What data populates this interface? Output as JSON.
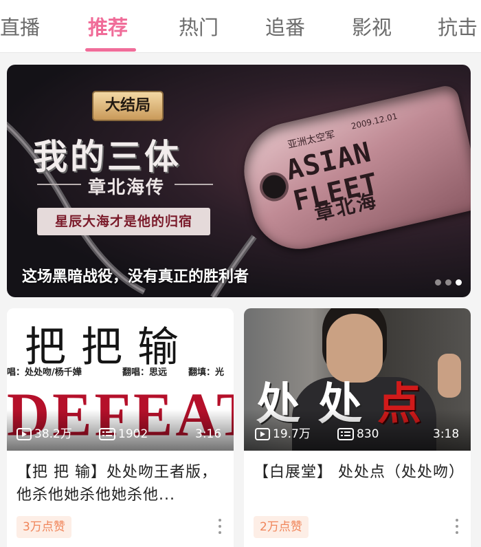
{
  "tabs": [
    {
      "label": "直播"
    },
    {
      "label": "推荐"
    },
    {
      "label": "热门"
    },
    {
      "label": "追番"
    },
    {
      "label": "影视"
    },
    {
      "label": "抗击"
    }
  ],
  "active_tab": "推荐",
  "banner": {
    "badge": "大结局",
    "title": "我的三体",
    "subtitle": "章北海传",
    "slogan": "星辰大海才是他的归宿",
    "tag_org": "亚洲太空军",
    "tag_date": "2009.12.01",
    "tag_fleet": "ASIAN FLEET",
    "tag_name": "章北海",
    "caption": "这场黑暗战役，没有真正的胜利者",
    "dots_count": 3,
    "active_dot": 2
  },
  "cards": [
    {
      "thumb": {
        "hand_title": "把把输",
        "credit_singer": "唱：处处吻/杨千嬅",
        "credit_cover": "翻唱：思远",
        "credit_lyrics": "翻填：光",
        "overlay_word": "DEFEAT"
      },
      "views": "38.2万",
      "comments": "1902",
      "duration": "3:16",
      "title": "【把 把 输】处处吻王者版，他杀他她杀他她杀他...",
      "likes": "3万点赞"
    },
    {
      "thumb": {
        "brush_chars": [
          "处",
          "处",
          "点"
        ]
      },
      "views": "19.7万",
      "comments": "830",
      "duration": "3:18",
      "title": "【白展堂】 处处点（处处吻）",
      "likes": "2万点赞"
    }
  ],
  "colors": {
    "accent": "#f06d99",
    "likes_text": "#f0855a",
    "likes_bg": "#fdeee6"
  }
}
